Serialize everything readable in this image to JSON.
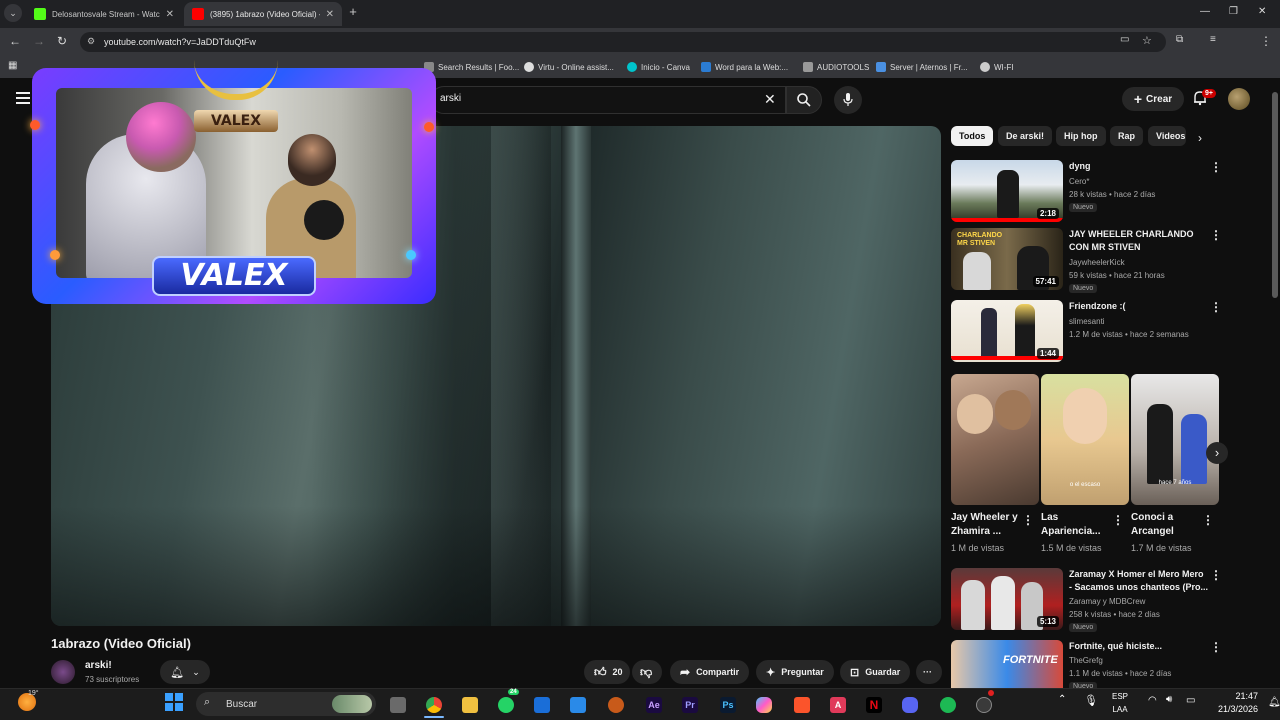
{
  "browser": {
    "tabs": [
      {
        "title": "Delosantosvale Stream - Watch",
        "favicon_color": "#53fc18"
      },
      {
        "title": "(3895) 1abrazo (Video Oficial) -",
        "favicon_color": "#ff0000"
      }
    ],
    "url": "youtube.com/watch?v=JaDDTduQtFw",
    "bookmarks": [
      {
        "label": "Search Results | Foo...",
        "color": "#888888"
      },
      {
        "label": "Virtu - Online assist...",
        "color": "#dddddd"
      },
      {
        "label": "Inicio - Canva",
        "color": "#00c4cc"
      },
      {
        "label": "Word para la Web:...",
        "color": "#2b7cd3"
      },
      {
        "label": "AUDIOTOOLS",
        "color": "#999999"
      },
      {
        "label": "Server | Aternos | Fr...",
        "color": "#4a90e2"
      },
      {
        "label": "WI-FI",
        "color": "#cccccc"
      }
    ]
  },
  "youtube": {
    "search_value": "arski",
    "create_label": "Crear",
    "notifications_badge": "9+",
    "chips": [
      "Todos",
      "De arski!",
      "Hip hop",
      "Rap",
      "Videos"
    ],
    "video": {
      "title": "1abrazo (Video Oficial)",
      "channel": "arski!",
      "subscribers": "73 suscriptores",
      "likes": "20",
      "share_label": "Compartir",
      "ask_label": "Preguntar",
      "save_label": "Guardar"
    },
    "overlay": {
      "top_logo": "VALEX",
      "banner": "VALEX"
    },
    "recommendations": [
      {
        "title": "dyng",
        "channel": "Cero*",
        "meta": "28 k vistas • hace 2 días",
        "badge": "Nuevo",
        "duration": "2:18"
      },
      {
        "title": "JAY WHEELER CHARLANDO CON MR STIVEN",
        "channel": "JaywheelerKick",
        "meta": "59 k vistas • hace 21 horas",
        "badge": "Nuevo",
        "duration": "57:41",
        "thumb_text": "CHARLANDO MR STIVEN"
      },
      {
        "title": "Friendzone :(",
        "channel": "slimesanti",
        "meta": "1.2 M de vistas • hace 2 semanas",
        "duration": "1:44"
      },
      {
        "title": "Zaramay X Homer el Mero Mero - Sacamos unos chanteos (Pro...",
        "channel": "Zaramay  y MDBCrew",
        "meta": "258 k vistas • hace 2 días",
        "badge": "Nuevo",
        "duration": "5:13"
      },
      {
        "title": "Fortnite, qué hiciste...",
        "channel": "TheGrefg",
        "meta": "1.1 M de vistas • hace 2 días",
        "badge": "Nuevo",
        "thumb_text": "FORTNITE"
      }
    ],
    "shorts": [
      {
        "title": "Jay Wheeler y Zhamira ...",
        "views": "1 M de vistas"
      },
      {
        "title": "Las Apariencia...",
        "views": "1.5 M de vistas",
        "thumb_text": "o el escaso"
      },
      {
        "title": "Conoci a Arcangel",
        "views": "1.7 M de vistas",
        "thumb_text": "hace 7 años"
      }
    ]
  },
  "taskbar": {
    "weather_temp": "19°",
    "search_placeholder": "Buscar",
    "whatsapp_badge": "24",
    "language": "ESP",
    "region": "LAA",
    "time": "21:47",
    "date": "21/3/2026"
  }
}
